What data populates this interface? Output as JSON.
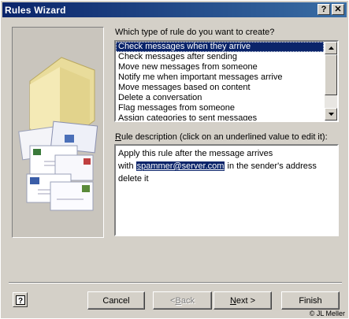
{
  "window": {
    "title": "Rules Wizard",
    "help_glyph": "?",
    "close_glyph": "✕"
  },
  "rule_type": {
    "label": "Which type of rule do you want to create?",
    "items": [
      "Check messages when they arrive",
      "Check messages after sending",
      "Move new messages from someone",
      "Notify me when important messages arrive",
      "Move messages based on content",
      "Delete a conversation",
      "Flag messages from someone",
      "Assign categories to sent messages"
    ],
    "selected_index": 0
  },
  "description": {
    "label_prefix": "R",
    "label_rest": "ule description (click on an underlined value to edit it):",
    "line1": "Apply this rule after the message arrives",
    "line2_prefix": "with ",
    "line2_link": "spammer@server.com",
    "line2_suffix": " in the sender's address",
    "line3": "delete it"
  },
  "buttons": {
    "cancel": "Cancel",
    "back_prefix": "< ",
    "back_key": "B",
    "back_rest": "ack",
    "next_key": "N",
    "next_rest": "ext >",
    "finish": "Finish"
  },
  "footer": {
    "copyright": "© JL Meller"
  },
  "colors": {
    "face": "#d4d0c8",
    "title_start": "#0a246a",
    "title_end": "#3a6ea5",
    "selection": "#0a246a"
  }
}
